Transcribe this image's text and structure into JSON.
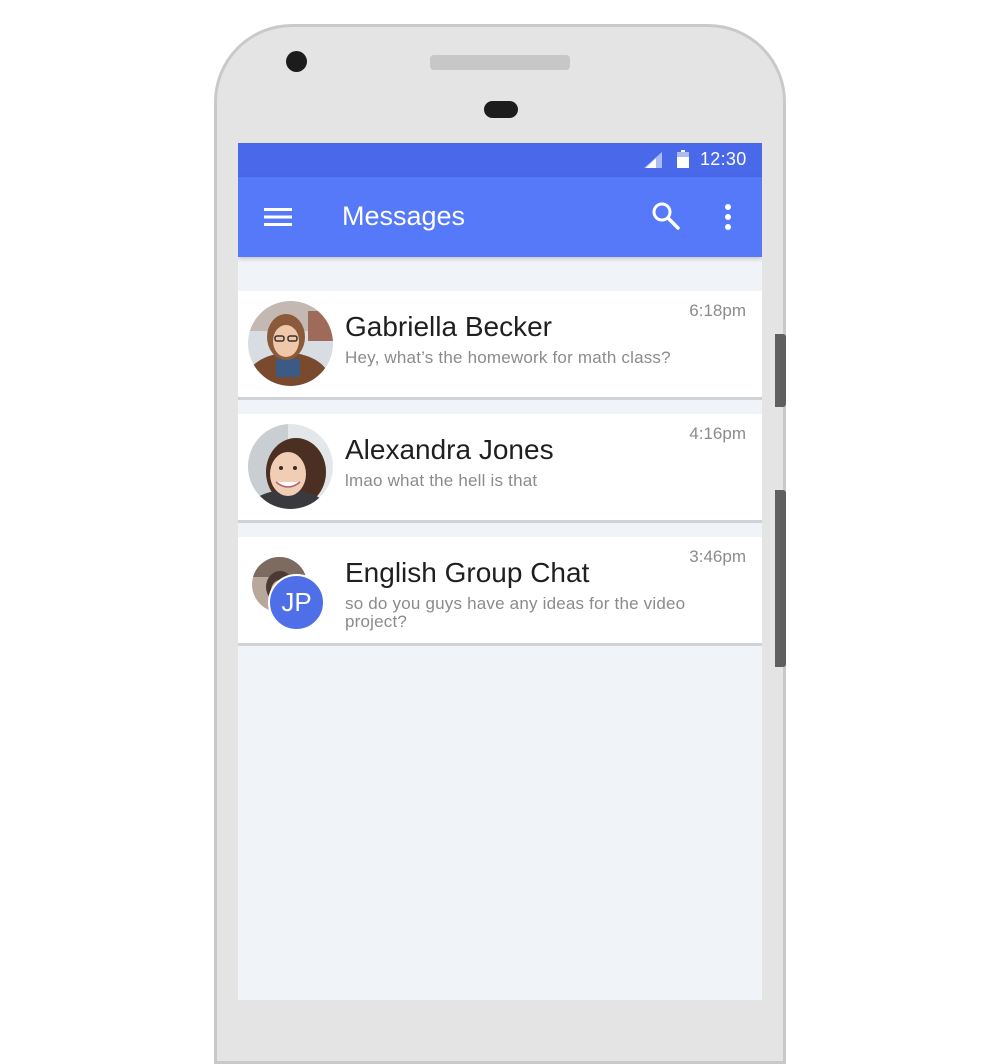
{
  "status_bar": {
    "time": "12:30",
    "signal_icon": "signal-icon",
    "battery_icon": "battery-icon"
  },
  "app_bar": {
    "title": "Messages",
    "menu_icon": "menu-icon",
    "search_icon": "search-icon",
    "more_icon": "more-vert-icon"
  },
  "conversations": [
    {
      "name": "Gabriella Becker",
      "preview": "Hey, what’s the homework for math class?",
      "time": "6:18pm",
      "avatar": "photo-avatar"
    },
    {
      "name": "Alexandra Jones",
      "preview": "lmao what the hell is that",
      "time": "4:16pm",
      "avatar": "photo-avatar"
    },
    {
      "name": "English Group Chat",
      "preview": "so do you guys have any ideas for the video project?",
      "time": "3:46pm",
      "avatar": "group-avatar",
      "group_initials": "JP"
    }
  ],
  "colors": {
    "status_bar": "#4968ea",
    "app_bar": "#5579f8",
    "screen_background": "#f0f3f7",
    "initials_avatar": "#4f6fe8"
  }
}
